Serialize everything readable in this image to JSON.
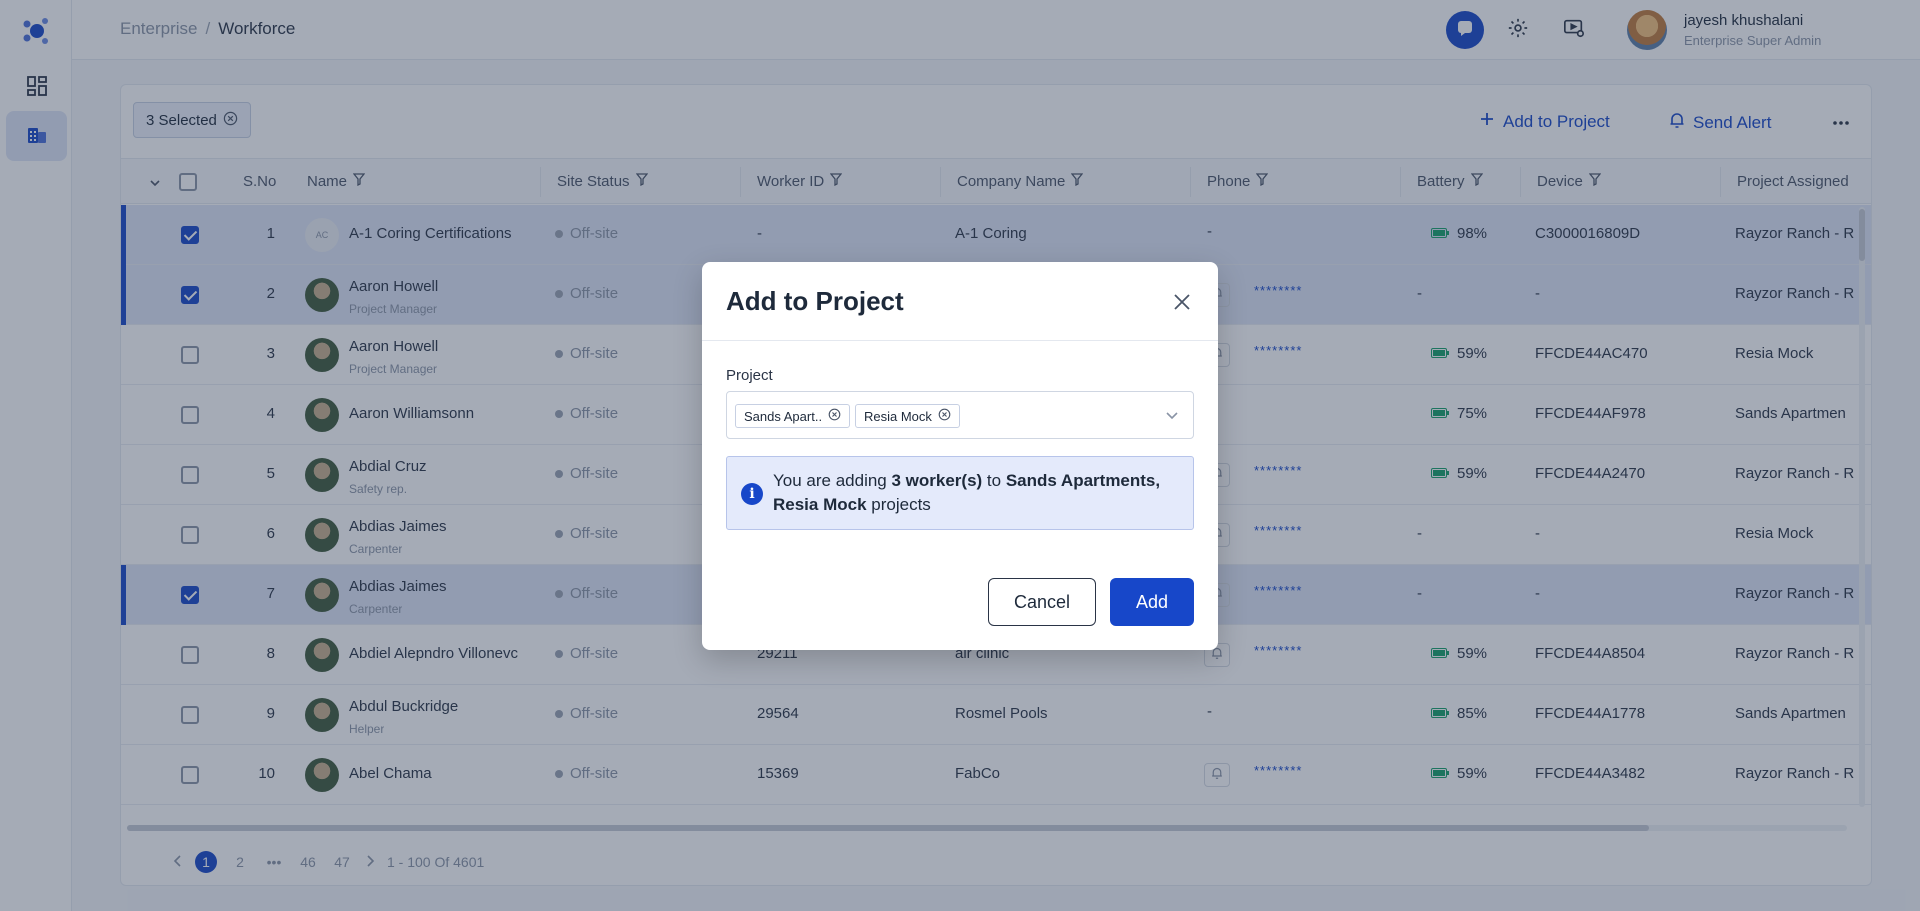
{
  "breadcrumb": {
    "parent": "Enterprise",
    "separator": "/",
    "current": "Workforce"
  },
  "user": {
    "name": "jayesh khushalani",
    "role": "Enterprise Super Admin"
  },
  "toolbar": {
    "selected_label": "3 Selected",
    "add_to_project": "Add to Project",
    "send_alert": "Send Alert"
  },
  "table": {
    "columns": [
      "S.No",
      "Name",
      "Site Status",
      "Worker ID",
      "Company Name",
      "Phone",
      "Battery",
      "Device",
      "Project Assigned"
    ],
    "rows": [
      {
        "sno": "1",
        "initials": "AC",
        "name": "A-1 Coring Certifications",
        "role": "",
        "status": "Off-site",
        "worker_id": "-",
        "company": "A-1 Coring",
        "phone": "-",
        "battery": "98%",
        "device": "C3000016809D",
        "project": "Rayzor Ranch - R",
        "selected": true
      },
      {
        "sno": "2",
        "name": "Aaron Howell",
        "role": "Project Manager",
        "status": "Off-site",
        "phone_masked": "********",
        "battery": "-",
        "device": "-",
        "project": "Rayzor Ranch - R",
        "selected": true
      },
      {
        "sno": "3",
        "name": "Aaron Howell",
        "role": "Project Manager",
        "status": "Off-site",
        "phone_masked": "********",
        "battery": "59%",
        "device": "FFCDE44AC470",
        "project": "Resia Mock",
        "selected": false
      },
      {
        "sno": "4",
        "name": "Aaron Williamsonn",
        "role": "",
        "status": "Off-site",
        "battery": "75%",
        "device": "FFCDE44AF978",
        "project": "Sands Apartmen",
        "selected": false
      },
      {
        "sno": "5",
        "name": "Abdial Cruz",
        "role": "Safety rep.",
        "status": "Off-site",
        "phone_masked": "********",
        "battery": "59%",
        "device": "FFCDE44A2470",
        "project": "Rayzor Ranch - R",
        "selected": false
      },
      {
        "sno": "6",
        "name": "Abdias Jaimes",
        "role": "Carpenter",
        "status": "Off-site",
        "phone_masked": "********",
        "battery": "-",
        "device": "-",
        "project": "Resia Mock",
        "selected": false
      },
      {
        "sno": "7",
        "name": "Abdias Jaimes",
        "role": "Carpenter",
        "status": "Off-site",
        "phone_masked": "********",
        "battery": "-",
        "device": "-",
        "project": "Rayzor Ranch - R",
        "selected": true
      },
      {
        "sno": "8",
        "name": "Abdiel Alepndro Villonevc",
        "role": "",
        "status": "Off-site",
        "worker_id": "29211",
        "company": "air clinic",
        "phone_masked": "********",
        "battery": "59%",
        "device": "FFCDE44A8504",
        "project": "Rayzor Ranch - R",
        "selected": false
      },
      {
        "sno": "9",
        "name": "Abdul Buckridge",
        "role": "Helper",
        "status": "Off-site",
        "worker_id": "29564",
        "company": "Rosmel Pools",
        "phone": "-",
        "battery": "85%",
        "device": "FFCDE44A1778",
        "project": "Sands Apartmen",
        "selected": false
      },
      {
        "sno": "10",
        "name": "Abel Chama",
        "role": "",
        "status": "Off-site",
        "worker_id": "15369",
        "company": "FabCo",
        "phone_masked": "********",
        "battery": "59%",
        "device": "FFCDE44A3482",
        "project": "Rayzor Ranch - R",
        "selected": false
      }
    ]
  },
  "pagination": {
    "pages": [
      "1",
      "2",
      "•••",
      "46",
      "47"
    ],
    "current": "1",
    "summary": "1 - 100 Of 4601"
  },
  "modal": {
    "title": "Add to Project",
    "field_label": "Project",
    "tags": [
      "Sands Apart..",
      "Resia Mock"
    ],
    "info_prefix": "You are adding ",
    "info_count": "3 worker(s)",
    "info_mid": " to ",
    "info_projects": "Sands Apartments, Resia Mock",
    "info_suffix": " projects",
    "cancel_label": "Cancel",
    "add_label": "Add"
  },
  "colors": {
    "accent": "#1747c9",
    "selected_row": "#dfe6f7",
    "battery": "#16a06a"
  }
}
